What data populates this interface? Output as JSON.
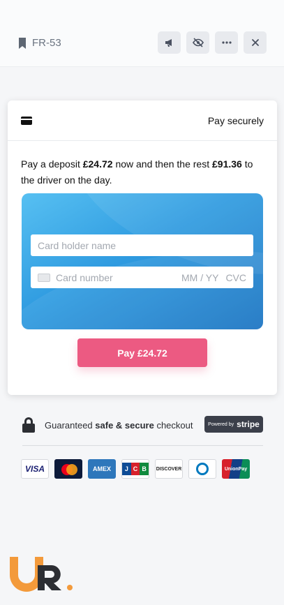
{
  "header": {
    "reference": "FR-53",
    "actions": [
      {
        "name": "megaphone-icon",
        "label": "announce"
      },
      {
        "name": "hide-icon",
        "label": "hide"
      },
      {
        "name": "more-icon",
        "label": "more"
      },
      {
        "name": "close-icon",
        "label": "close"
      }
    ]
  },
  "payment": {
    "title": "Pay securely",
    "deposit_prefix": "Pay a deposit ",
    "deposit_amount": "£24.72",
    "deposit_middle": " now and then the rest ",
    "rest_amount": "£91.36",
    "deposit_suffix": " to the driver on the day.",
    "card_holder_placeholder": "Card holder name",
    "card_number_placeholder": "Card number",
    "expiry_placeholder": "MM / YY",
    "cvc_placeholder": "CVC",
    "pay_button": "Pay £24.72"
  },
  "trust": {
    "prefix": "Guaranteed ",
    "bold": "safe & secure",
    "suffix": " checkout",
    "badge_small": "Powered by",
    "badge_brand": "stripe"
  },
  "card_brands": [
    {
      "name": "visa",
      "text": "VISA"
    },
    {
      "name": "mastercard",
      "text": ""
    },
    {
      "name": "amex",
      "text": "AMEX"
    },
    {
      "name": "jcb",
      "text": "JCB"
    },
    {
      "name": "discover",
      "text": "DISCOVER"
    },
    {
      "name": "diners",
      "text": ""
    },
    {
      "name": "unionpay",
      "text": "UnionPay"
    }
  ],
  "colors": {
    "accent": "#ec5a82",
    "panel": "#2f9be0",
    "brand_orange": "#f39a3b",
    "brand_dark": "#2c2e33"
  },
  "brand_logo": "UR."
}
